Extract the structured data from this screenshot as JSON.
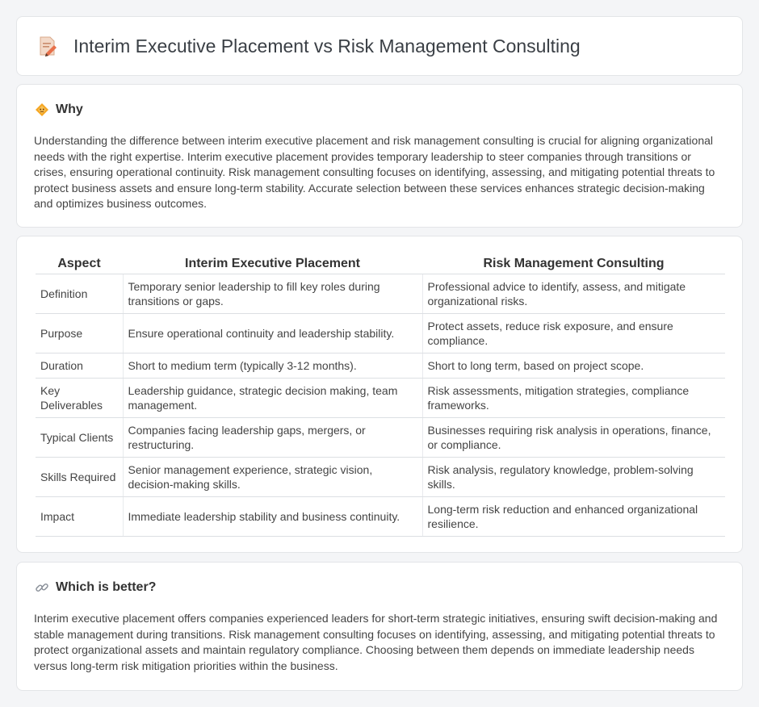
{
  "header": {
    "title": "Interim Executive Placement vs Risk Management Consulting",
    "icon": "document-pencil-icon"
  },
  "why": {
    "title": "Why",
    "icon": "diamond-warning-icon",
    "text": "Understanding the difference between interim executive placement and risk management consulting is crucial for aligning organizational needs with the right expertise. Interim executive placement provides temporary leadership to steer companies through transitions or crises, ensuring operational continuity. Risk management consulting focuses on identifying, assessing, and mitigating potential threats to protect business assets and ensure long-term stability. Accurate selection between these services enhances strategic decision-making and optimizes business outcomes."
  },
  "comparison": {
    "headers": [
      "Aspect",
      "Interim Executive Placement",
      "Risk Management Consulting"
    ],
    "rows": [
      {
        "aspect": "Definition",
        "iep": "Temporary senior leadership to fill key roles during transitions or gaps.",
        "rmc": "Professional advice to identify, assess, and mitigate organizational risks."
      },
      {
        "aspect": "Purpose",
        "iep": "Ensure operational continuity and leadership stability.",
        "rmc": "Protect assets, reduce risk exposure, and ensure compliance."
      },
      {
        "aspect": "Duration",
        "iep": "Short to medium term (typically 3-12 months).",
        "rmc": "Short to long term, based on project scope."
      },
      {
        "aspect": "Key Deliverables",
        "iep": "Leadership guidance, strategic decision making, team management.",
        "rmc": "Risk assessments, mitigation strategies, compliance frameworks."
      },
      {
        "aspect": "Typical Clients",
        "iep": "Companies facing leadership gaps, mergers, or restructuring.",
        "rmc": "Businesses requiring risk analysis in operations, finance, or compliance."
      },
      {
        "aspect": "Skills Required",
        "iep": "Senior management experience, strategic vision, decision-making skills.",
        "rmc": "Risk analysis, regulatory knowledge, problem-solving skills."
      },
      {
        "aspect": "Impact",
        "iep": "Immediate leadership stability and business continuity.",
        "rmc": "Long-term risk reduction and enhanced organizational resilience."
      }
    ]
  },
  "better": {
    "title": "Which is better?",
    "icon": "link-icon",
    "text": "Interim executive placement offers companies experienced leaders for short-term strategic initiatives, ensuring swift decision-making and stable management during transitions. Risk management consulting focuses on identifying, assessing, and mitigating potential threats to protect organizational assets and maintain regulatory compliance. Choosing between them depends on immediate leadership needs versus long-term risk mitigation priorities within the business."
  }
}
